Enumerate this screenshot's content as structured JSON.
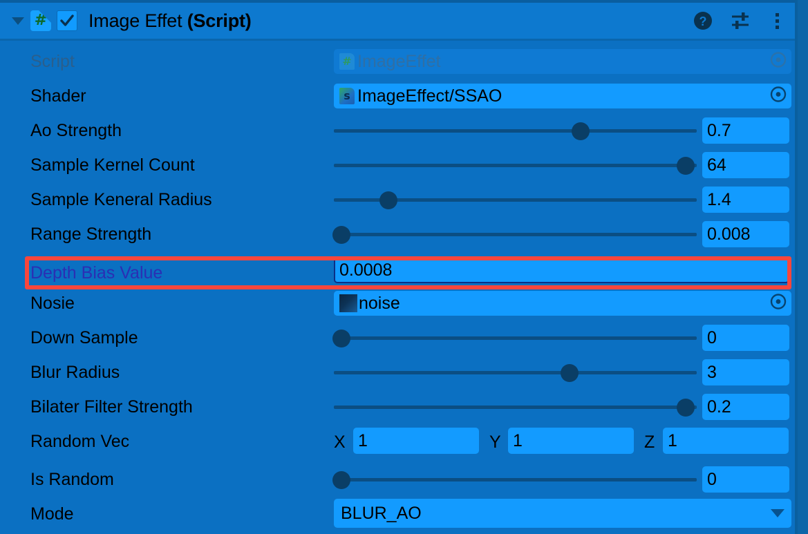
{
  "header": {
    "title_normal": "Image Effet ",
    "title_bold": "(Script)",
    "foldout_icon": "triangle-down-icon",
    "script_icon_glyph": "#",
    "enabled_checkbox": true,
    "help_icon": "help-icon",
    "preset_icon": "preset-sliders-icon",
    "more_icon": "more-vertical-icon"
  },
  "colors": {
    "panel_bg": "#0b70c2",
    "header_bg": "#0d79cf",
    "field_bg": "#139bff",
    "field_disabled_bg": "#0f7ad3",
    "slider_track": "#0b4e83",
    "slider_knob": "#0a3e66",
    "highlight_red": "#f9463c",
    "label": "#000000",
    "label_dim": "#2a5f8d",
    "label_selected": "#2a2fb4"
  },
  "rows": [
    {
      "name": "script",
      "label": "Script",
      "label_state": "dim",
      "control": "object-field",
      "value": "ImageEffet",
      "icon": "csharp-script-icon",
      "disabled": true
    },
    {
      "name": "shader",
      "label": "Shader",
      "label_state": "normal",
      "control": "object-field",
      "value": "ImageEffect/SSAO",
      "icon": "shader-icon",
      "disabled": false
    },
    {
      "name": "ao-strength",
      "label": "Ao Strength",
      "label_state": "normal",
      "control": "slider",
      "value": "0.7",
      "knob_pct": 68
    },
    {
      "name": "sample-kernel-count",
      "label": "Sample Kernel Count",
      "label_state": "normal",
      "control": "slider",
      "value": "64",
      "knob_pct": 97
    },
    {
      "name": "sample-kenral-radius",
      "label": "Sample Keneral Radius",
      "label_state": "normal",
      "control": "slider",
      "value": "1.4",
      "knob_pct": 15
    },
    {
      "name": "range-strength",
      "label": "Range Strength",
      "label_state": "normal",
      "control": "slider",
      "value": "0.008",
      "knob_pct": 2
    },
    {
      "name": "depth-bias-value",
      "label": "Depth Bias Value",
      "label_state": "selected",
      "control": "text-field-focused",
      "value": "0.0008",
      "highlighted": true
    },
    {
      "name": "nosie",
      "label": "Nosie",
      "label_state": "normal",
      "control": "object-field",
      "value": "noise",
      "icon": "texture-thumbnail-icon",
      "disabled": false
    },
    {
      "name": "down-sample",
      "label": "Down Sample",
      "label_state": "normal",
      "control": "slider",
      "value": "0",
      "knob_pct": 2
    },
    {
      "name": "blur-radius",
      "label": "Blur Radius",
      "label_state": "normal",
      "control": "slider",
      "value": "3",
      "knob_pct": 65
    },
    {
      "name": "bilater-filter-strength",
      "label": "Bilater Filter Strength",
      "label_state": "normal",
      "control": "slider",
      "value": "0.2",
      "knob_pct": 97
    },
    {
      "name": "random-vec",
      "label": "Random Vec",
      "label_state": "normal",
      "control": "vector3",
      "axes": [
        {
          "axis": "X",
          "value": "1"
        },
        {
          "axis": "Y",
          "value": "1"
        },
        {
          "axis": "Z",
          "value": "1"
        }
      ]
    },
    {
      "name": "is-random",
      "label": "Is Random",
      "label_state": "normal",
      "control": "slider",
      "value": "0",
      "knob_pct": 2
    },
    {
      "name": "mode",
      "label": "Mode",
      "label_state": "normal",
      "control": "dropdown",
      "value": "BLUR_AO"
    }
  ]
}
